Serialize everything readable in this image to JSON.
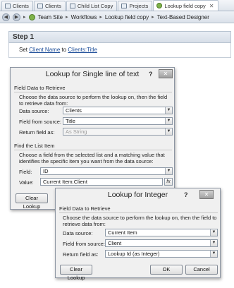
{
  "tabs": [
    {
      "label": "Clients",
      "icon": "list-icon",
      "active": false
    },
    {
      "label": "Clients",
      "icon": "list-icon",
      "active": false
    },
    {
      "label": "Child List Copy",
      "icon": "list-icon",
      "active": false
    },
    {
      "label": "Projects",
      "icon": "list-icon",
      "active": false
    },
    {
      "label": "Lookup field copy",
      "icon": "workflow-icon",
      "active": true
    }
  ],
  "breadcrumb": {
    "items": [
      "Team Site",
      "Workflows",
      "Lookup field copy",
      "Text-Based Designer"
    ]
  },
  "step": {
    "title": "Step 1",
    "prefix": "Set",
    "field_link": "Client Name",
    "middle": "to",
    "value_link": "Clients:Title"
  },
  "dialog1": {
    "title": "Lookup for Single line of text",
    "section1": "Field Data to Retrieve",
    "desc1": "Choose the data source to perform the lookup on, then the field to retrieve data from:",
    "data_source_label": "Data source:",
    "data_source_value": "Clients",
    "field_from_source_label": "Field from source:",
    "field_from_source_value": "Title",
    "return_field_as_label": "Return field as:",
    "return_field_as_value": "As String",
    "section2": "Find the List Item",
    "desc2": "Choose a field from the selected list and a matching value that identifies the specific item you want from the data source:",
    "field_label": "Field:",
    "field_value": "ID",
    "value_label": "Value:",
    "value_value": "Current Item:Client",
    "fx_label": "fx",
    "clear_lookup": "Clear Lookup"
  },
  "dialog2": {
    "title": "Lookup for Integer",
    "help": "?",
    "section1": "Field Data to Retrieve",
    "desc1": "Choose the data source to perform the lookup on, then the field to retrieve data from:",
    "data_source_label": "Data source:",
    "data_source_value": "Current Item",
    "field_from_source_label": "Field from source:",
    "field_from_source_value": "Client",
    "return_field_as_label": "Return field as:",
    "return_field_as_value": "Lookup Id (as Integer)",
    "clear_lookup": "Clear Lookup",
    "ok": "OK",
    "cancel": "Cancel"
  },
  "glyphs": {
    "close": "✕",
    "dropdown": "▼",
    "help": "?",
    "back": "◀",
    "forward": "▶",
    "separator": "▸"
  }
}
